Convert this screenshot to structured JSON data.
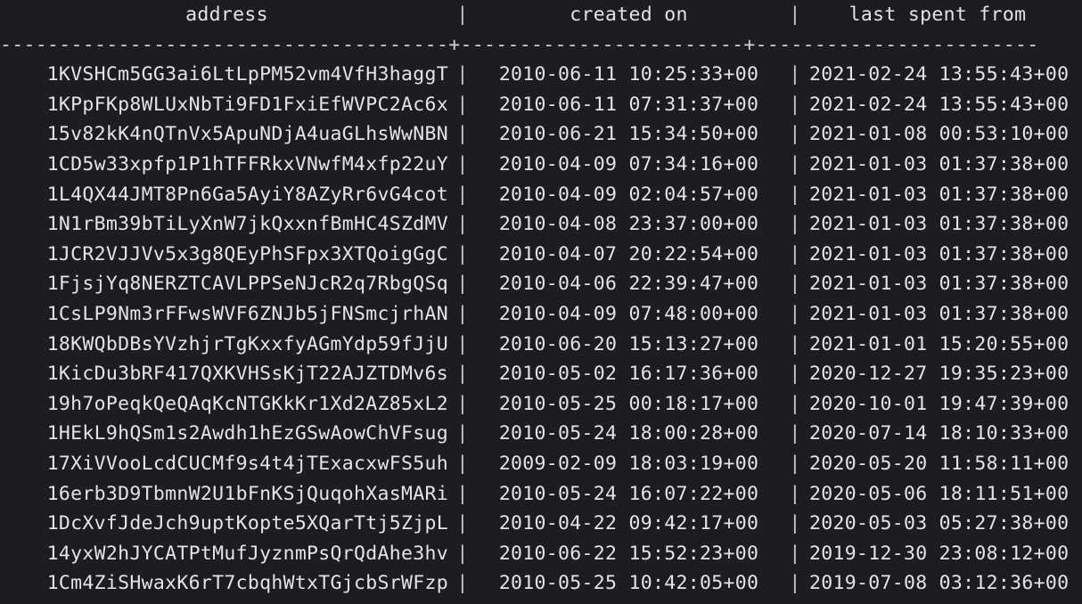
{
  "table": {
    "columns": [
      "address",
      "created on",
      "last spent from"
    ],
    "divider": "--------------------------------------+------------------------+------------------------",
    "rows": [
      {
        "address": "1KVSHCm5GG3ai6LtLpPM52vm4VfH3haggT",
        "created_on": "2010-06-11 10:25:33+00",
        "last_spent_from": "2021-02-24 13:55:43+00"
      },
      {
        "address": "1KPpFKp8WLUxNbTi9FD1FxiEfWVPC2Ac6x",
        "created_on": "2010-06-11 07:31:37+00",
        "last_spent_from": "2021-02-24 13:55:43+00"
      },
      {
        "address": "15v82kK4nQTnVx5ApuNDjA4uaGLhsWwNBN",
        "created_on": "2010-06-21 15:34:50+00",
        "last_spent_from": "2021-01-08 00:53:10+00"
      },
      {
        "address": "1CD5w33xpfp1P1hTFFRkxVNwfM4xfp22uY",
        "created_on": "2010-04-09 07:34:16+00",
        "last_spent_from": "2021-01-03 01:37:38+00"
      },
      {
        "address": "1L4QX44JMT8Pn6Ga5AyiY8AZyRr6vG4cot",
        "created_on": "2010-04-09 02:04:57+00",
        "last_spent_from": "2021-01-03 01:37:38+00"
      },
      {
        "address": "1N1rBm39bTiLyXnW7jkQxxnfBmHC4SZdMV",
        "created_on": "2010-04-08 23:37:00+00",
        "last_spent_from": "2021-01-03 01:37:38+00"
      },
      {
        "address": "1JCR2VJJVv5x3g8QEyPhSFpx3XTQoigGgC",
        "created_on": "2010-04-07 20:22:54+00",
        "last_spent_from": "2021-01-03 01:37:38+00"
      },
      {
        "address": "1FjsjYq8NERZTCAVLPPSeNJcR2q7RbgQSq",
        "created_on": "2010-04-06 22:39:47+00",
        "last_spent_from": "2021-01-03 01:37:38+00"
      },
      {
        "address": "1CsLP9Nm3rFFwsWVF6ZNJb5jFNSmcjrhAN",
        "created_on": "2010-04-09 07:48:00+00",
        "last_spent_from": "2021-01-03 01:37:38+00"
      },
      {
        "address": "18KWQbDBsYVzhjrTgKxxfyAGmYdp59fJjU",
        "created_on": "2010-06-20 15:13:27+00",
        "last_spent_from": "2021-01-01 15:20:55+00"
      },
      {
        "address": "1KicDu3bRF417QXKVHSsKjT22AJZTDMv6s",
        "created_on": "2010-05-02 16:17:36+00",
        "last_spent_from": "2020-12-27 19:35:23+00"
      },
      {
        "address": "19h7oPeqkQeQAqKcNTGKkKr1Xd2AZ85xL2",
        "created_on": "2010-05-25 00:18:17+00",
        "last_spent_from": "2020-10-01 19:47:39+00"
      },
      {
        "address": "1HEkL9hQSm1s2Awdh1hEzGSwAowChVFsug",
        "created_on": "2010-05-24 18:00:28+00",
        "last_spent_from": "2020-07-14 18:10:33+00"
      },
      {
        "address": "17XiVVooLcdCUCMf9s4t4jTExacxwFS5uh",
        "created_on": "2009-02-09 18:03:19+00",
        "last_spent_from": "2020-05-20 11:58:11+00"
      },
      {
        "address": "16erb3D9TbmnW2U1bFnKSjQuqohXasMARi",
        "created_on": "2010-05-24 16:07:22+00",
        "last_spent_from": "2020-05-06 18:11:51+00"
      },
      {
        "address": "1DcXvfJdeJch9uptKopte5XQarTtj5ZjpL",
        "created_on": "2010-04-22 09:42:17+00",
        "last_spent_from": "2020-05-03 05:27:38+00"
      },
      {
        "address": "14yxW2hJYCATPtMufJyznmPsQrQdAhe3hv",
        "created_on": "2010-06-22 15:52:23+00",
        "last_spent_from": "2019-12-30 23:08:12+00"
      },
      {
        "address": "1Cm4ZiSHwaxK6rT7cbqhWtxTGjcbSrWFzp",
        "created_on": "2010-05-25 10:42:05+00",
        "last_spent_from": "2019-07-08 03:12:36+00"
      }
    ]
  }
}
